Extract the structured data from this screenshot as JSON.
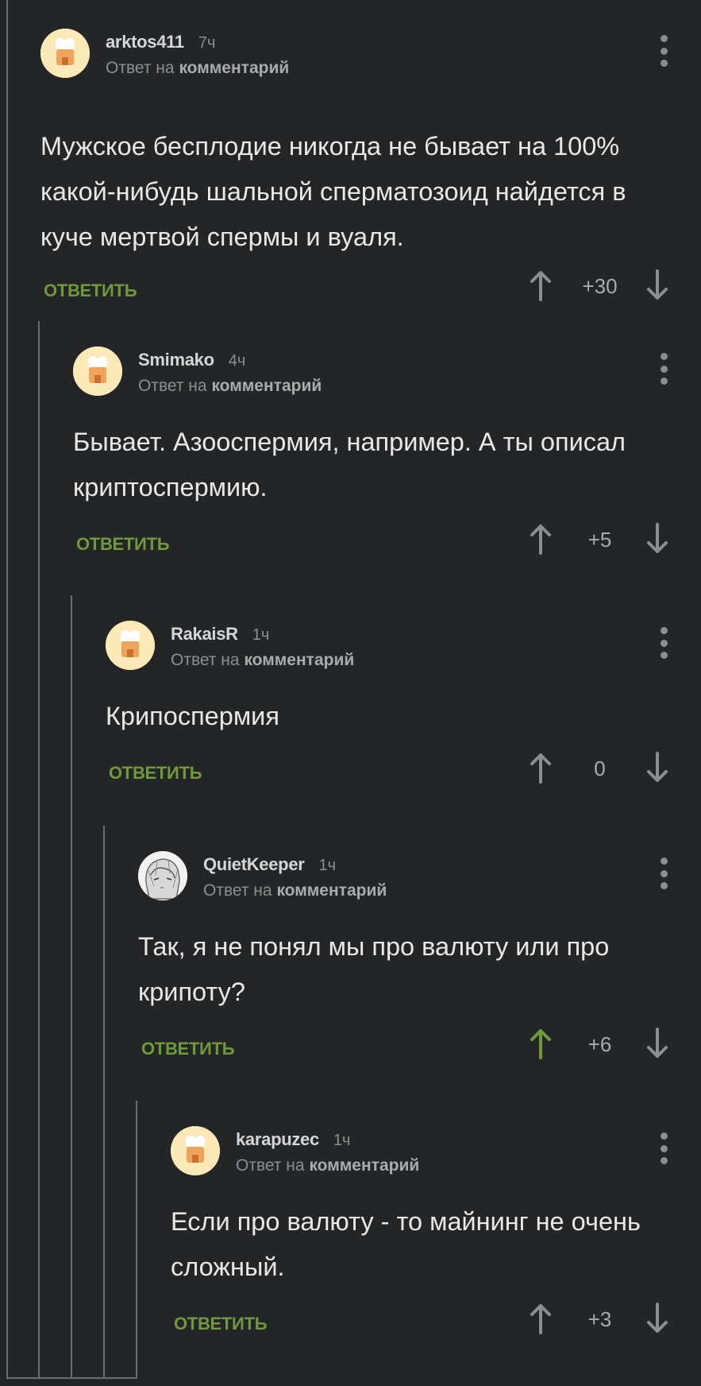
{
  "colors": {
    "background": "#242526",
    "reply_green": "#6f9a3c",
    "upvoted_green": "#6f9a3c",
    "muted_text": "#8c8e90",
    "thread_line": "#6a6c6e"
  },
  "comments": [
    {
      "author": "arktos411",
      "time": "7ч",
      "reply_prefix": "Ответ на",
      "reply_link": "комментарий",
      "text": "Мужское бесплодие никогда не бывает на 100% какой-нибудь шальной сперматозоид найдется в куче мертвой спермы и вуаля.",
      "reply_label": "ОТВЕТИТЬ",
      "score": "+30",
      "avatar": "default-avatar-icon"
    },
    {
      "author": "Smimako",
      "time": "4ч",
      "reply_prefix": "Ответ на",
      "reply_link": "комментарий",
      "text": "Бывает. Азооспермия, например. А ты описал криптоспермию.",
      "reply_label": "ОТВЕТИТЬ",
      "score": "+5",
      "avatar": "default-avatar-icon"
    },
    {
      "author": "RakaisR",
      "time": "1ч",
      "reply_prefix": "Ответ на",
      "reply_link": "комментарий",
      "text": "Крипоспермия",
      "reply_label": "ОТВЕТИТЬ",
      "score": "0",
      "avatar": "default-avatar-icon"
    },
    {
      "author": "QuietKeeper",
      "time": "1ч",
      "reply_prefix": "Ответ на",
      "reply_link": "комментарий",
      "text": "Так, я не понял мы про валюту или про крипоту?",
      "reply_label": "ОТВЕТИТЬ",
      "score": "+6",
      "upvoted": true,
      "avatar": "anime-sketch-avatar-icon"
    },
    {
      "author": "karapuzec",
      "time": "1ч",
      "reply_prefix": "Ответ на",
      "reply_link": "комментарий",
      "text": "Если про валюту - то майнинг не очень сложный.",
      "reply_label": "ОТВЕТИТЬ",
      "score": "+3",
      "avatar": "default-avatar-icon"
    }
  ]
}
